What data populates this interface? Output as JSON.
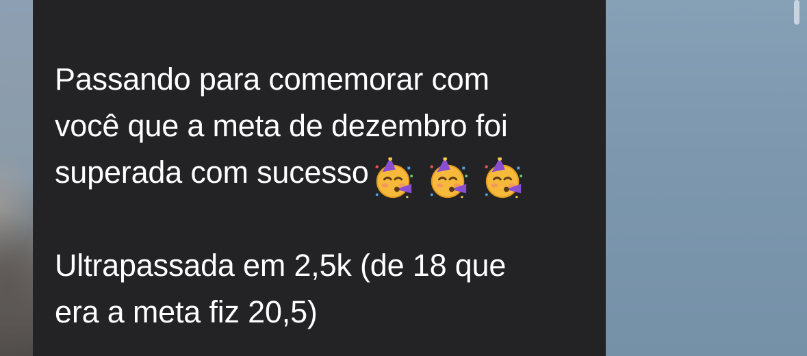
{
  "message": {
    "lines": [
      "Passando para comemorar com",
      "você que a meta de dezembro foi",
      "superada com sucesso"
    ],
    "emojis": [
      "partying-face-icon",
      "partying-face-icon",
      "partying-face-icon"
    ],
    "lines2": [
      "Ultrapassada em 2,5k (de 18 que",
      "era a meta fiz 20,5)"
    ]
  },
  "colors": {
    "bubble": "#232326",
    "text": "#ffffff",
    "emoji_face": "#f7b93b",
    "emoji_hat": "#8a4fd1"
  }
}
